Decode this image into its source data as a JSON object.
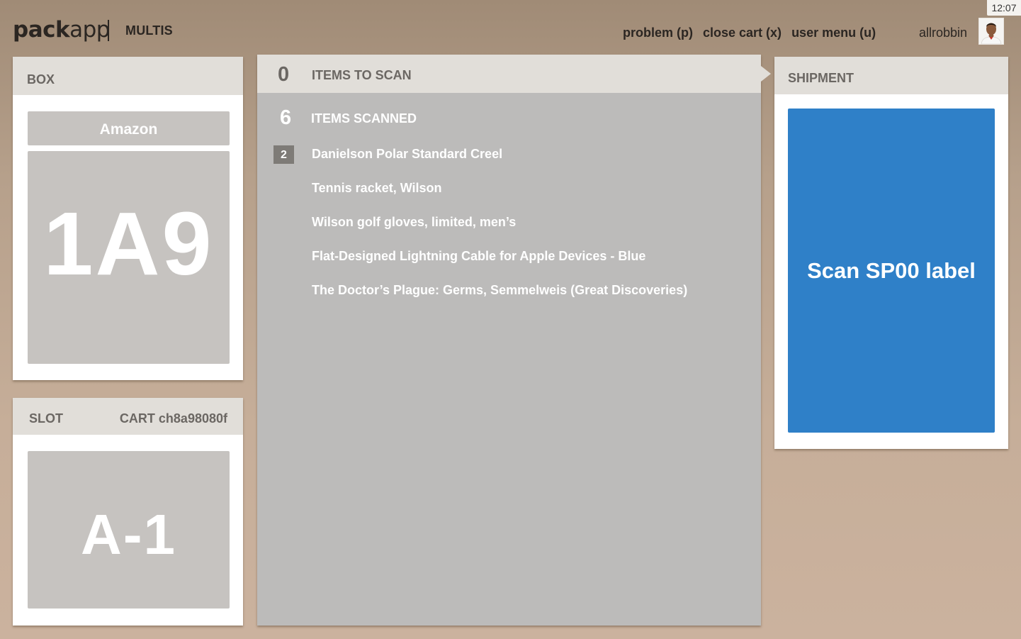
{
  "header": {
    "logo_part1": "pack",
    "logo_part2": "app",
    "mode": "MULTIS",
    "clock": "12:07",
    "menu": [
      {
        "label": "problem (p)"
      },
      {
        "label": "close cart (x)"
      },
      {
        "label": "user menu (u)"
      }
    ],
    "username": "allrobbin"
  },
  "box": {
    "title": "BOX",
    "carrier": "Amazon",
    "code": "1A9"
  },
  "slot": {
    "title": "SLOT",
    "cart": "CART ch8a98080f",
    "code": "A-1"
  },
  "items": {
    "to_scan_count": "0",
    "to_scan_label": "ITEMS TO SCAN",
    "scanned_count": "6",
    "scanned_label": "ITEMS SCANNED",
    "scanned": [
      {
        "qty": "2",
        "name": "Danielson Polar Standard Creel"
      },
      {
        "qty": "",
        "name": "Tennis racket, Wilson"
      },
      {
        "qty": "",
        "name": "Wilson golf gloves, limited, men’s"
      },
      {
        "qty": "",
        "name": "Flat-Designed Lightning Cable for Apple Devices - Blue"
      },
      {
        "qty": "",
        "name": "The Doctor’s Plague: Germs, Semmelweis (Great Discoveries)"
      }
    ]
  },
  "shipment": {
    "title": "SHIPMENT",
    "action": "Scan SP00 label"
  },
  "colors": {
    "background": "#b6a08b",
    "card_header": "#e1ded9",
    "panel_gray": "#c6c3c0",
    "items_panel": "#bcbbba",
    "qty_badge": "#7e7b77",
    "action_blue": "#2f80c8"
  }
}
